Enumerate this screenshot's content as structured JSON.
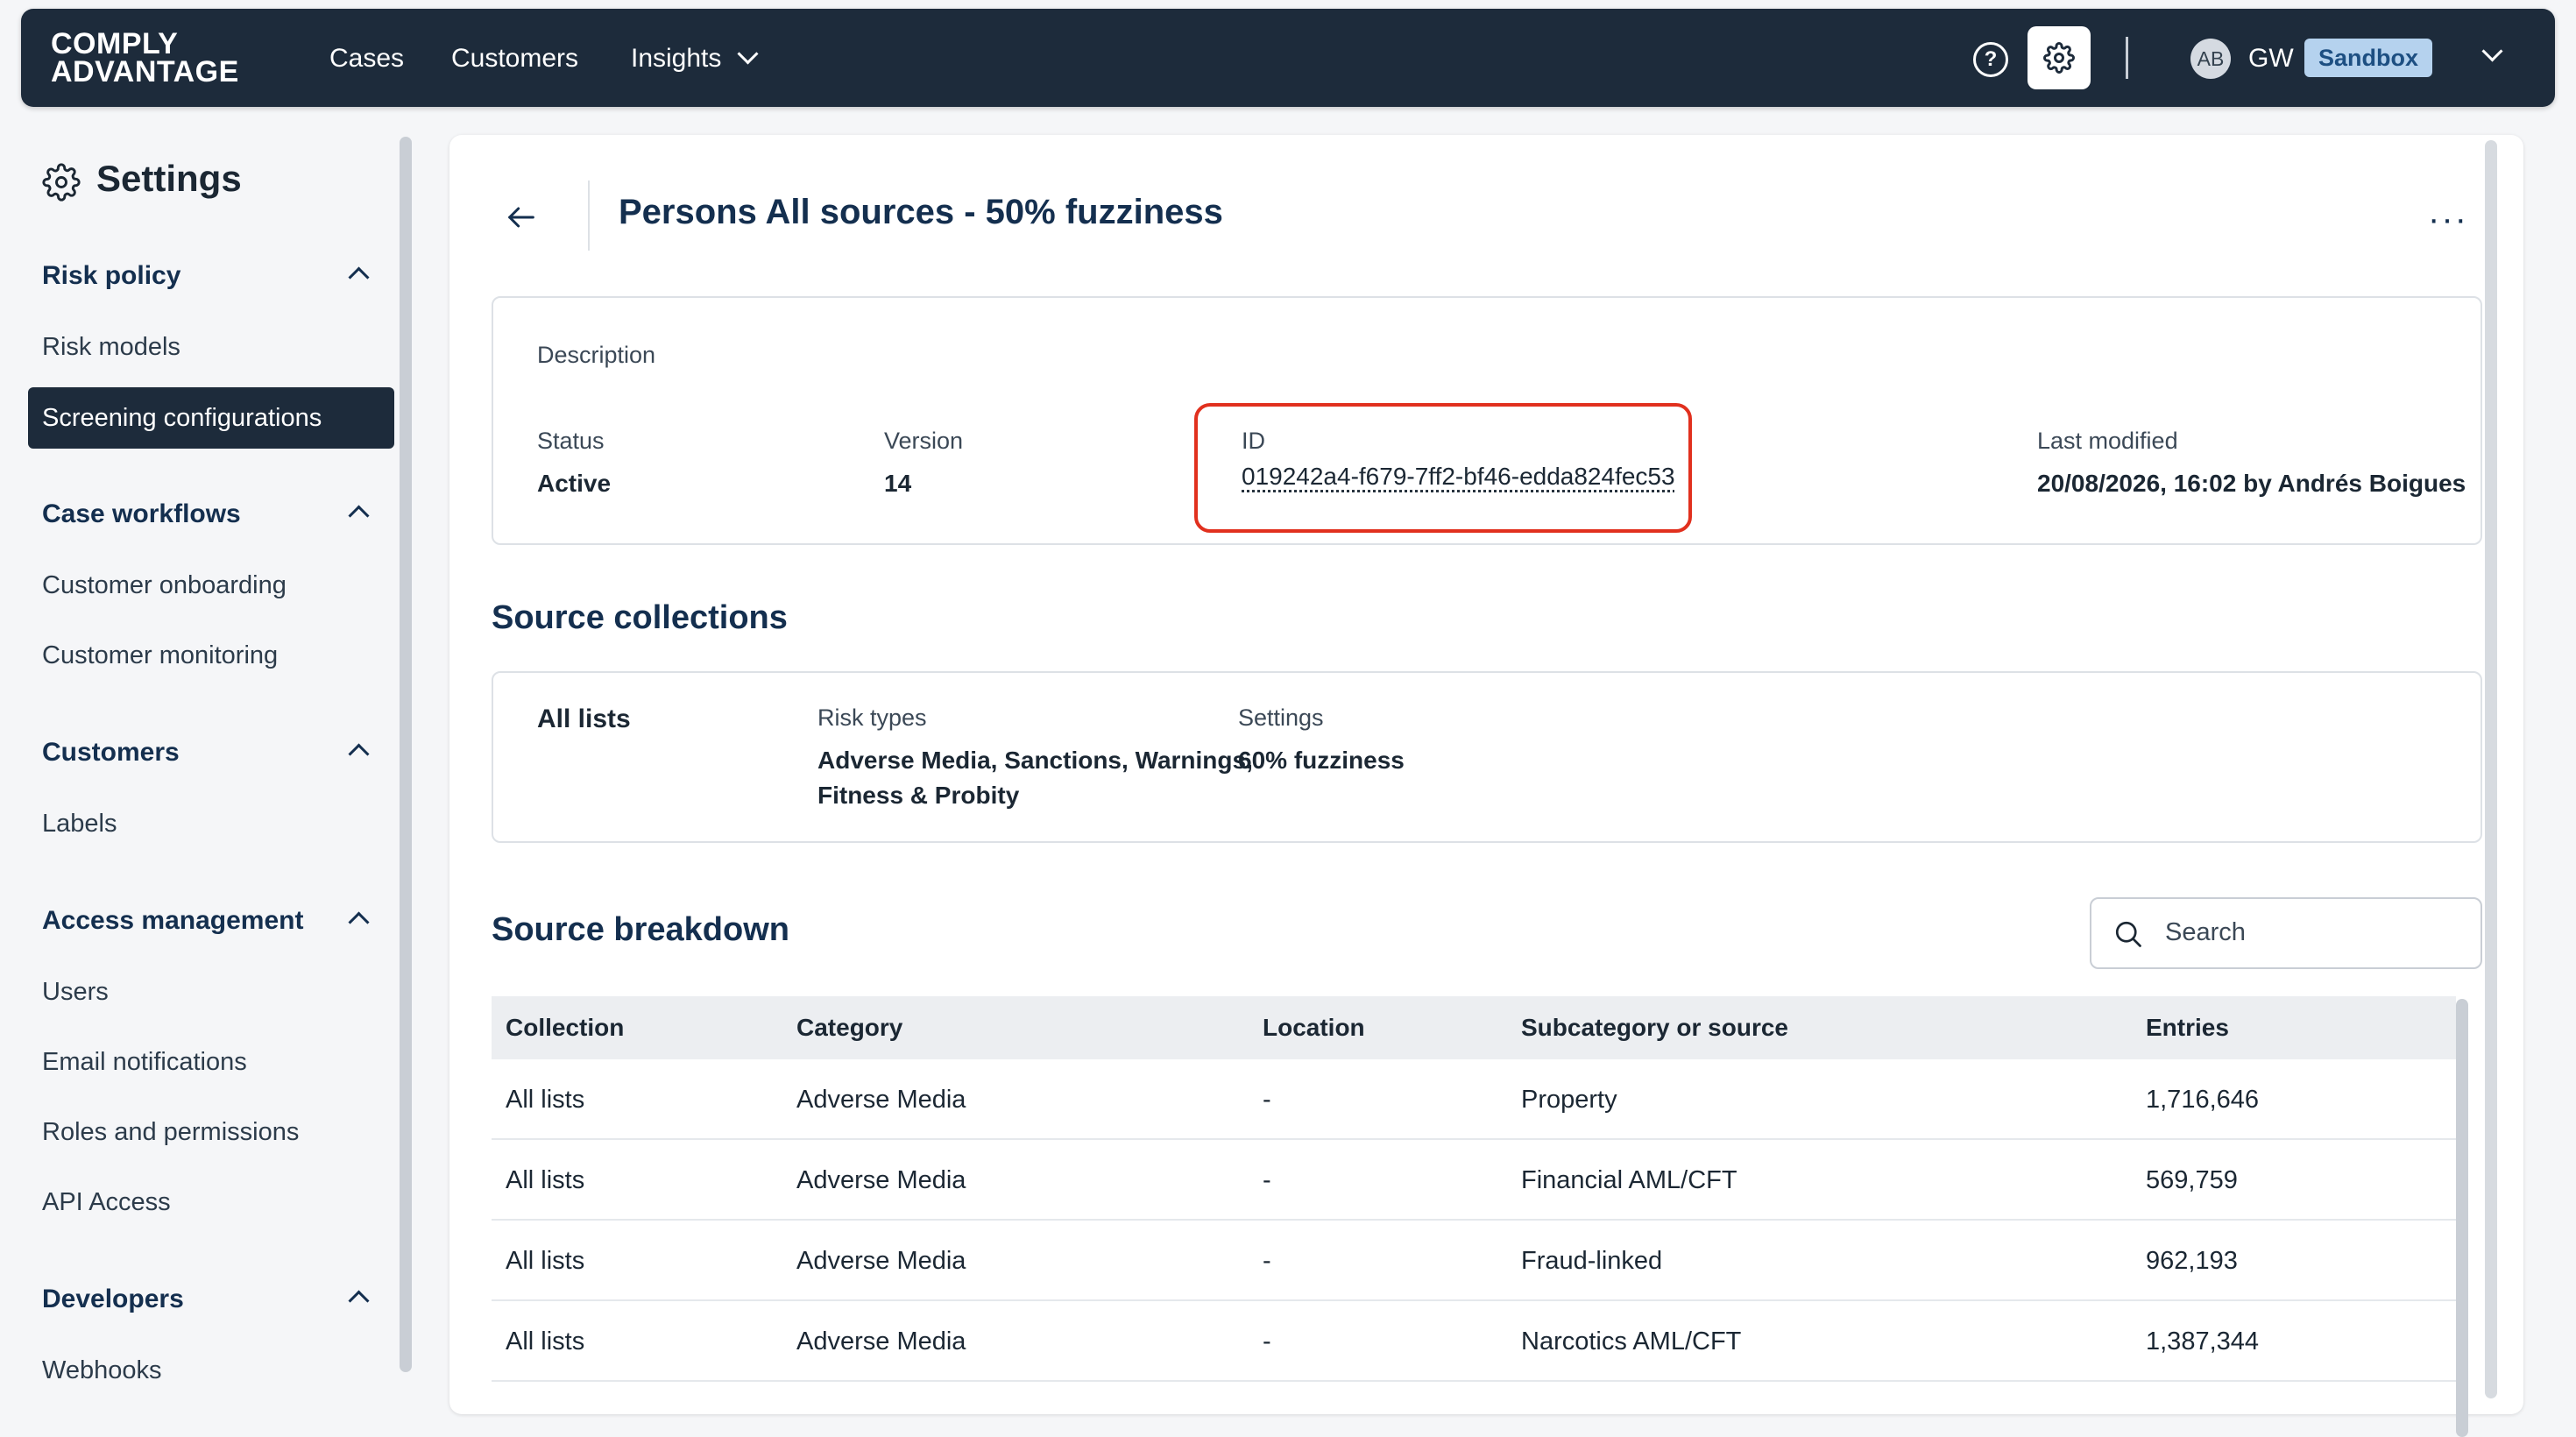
{
  "nav": {
    "logo_line1": "COMPLY",
    "logo_line2": "ADVANTAGE",
    "items": [
      "Cases",
      "Customers",
      "Insights"
    ],
    "avatar_initials": "AB",
    "user_initials": "GW",
    "environment": "Sandbox",
    "icons": [
      "help-icon",
      "gear-icon",
      "chevron-down-icon"
    ]
  },
  "sidebar": {
    "title": "Settings",
    "sections": [
      {
        "label": "Risk policy",
        "items": [
          "Risk models",
          "Screening configurations"
        ]
      },
      {
        "label": "Case workflows",
        "items": [
          "Customer onboarding",
          "Customer monitoring"
        ]
      },
      {
        "label": "Customers",
        "items": [
          "Labels"
        ]
      },
      {
        "label": "Access management",
        "items": [
          "Users",
          "Email notifications",
          "Roles and permissions",
          "API Access"
        ]
      },
      {
        "label": "Developers",
        "items": [
          "Webhooks"
        ]
      }
    ],
    "active_item": "Screening configurations"
  },
  "page": {
    "title": "Persons All sources - 50% fuzziness",
    "more_menu": "···"
  },
  "details": {
    "description_label": "Description",
    "status_label": "Status",
    "status_value": "Active",
    "version_label": "Version",
    "version_value": "14",
    "id_label": "ID",
    "id_value": "019242a4-f679-7ff2-bf46-edda824fec53",
    "modified_label": "Last modified",
    "modified_value": "20/08/2026, 16:02 by Andrés Boigues",
    "highlight_color": "#e1301e"
  },
  "source_collections": {
    "title": "Source collections",
    "collection_name": "All lists",
    "risk_types_label": "Risk types",
    "risk_types_line1": "Adverse Media, Sanctions, Warnings,",
    "risk_types_line2": "Fitness & Probity",
    "settings_label": "Settings",
    "settings_value": "60% fuzziness"
  },
  "source_breakdown": {
    "title": "Source breakdown",
    "search_placeholder": "Search",
    "columns": [
      "Collection",
      "Category",
      "Location",
      "Subcategory or source",
      "Entries"
    ],
    "rows": [
      [
        "All lists",
        "Adverse Media",
        "-",
        "Property",
        "1,716,646"
      ],
      [
        "All lists",
        "Adverse Media",
        "-",
        "Financial AML/CFT",
        "569,759"
      ],
      [
        "All lists",
        "Adverse Media",
        "-",
        "Fraud-linked",
        "962,193"
      ],
      [
        "All lists",
        "Adverse Media",
        "-",
        "Narcotics AML/CFT",
        "1,387,344"
      ]
    ]
  },
  "colors": {
    "nav_bg": "#1d2b3b",
    "heading": "#142f4f",
    "sandbox_bg": "#b5d2ee",
    "sandbox_text": "#1d4f82"
  }
}
